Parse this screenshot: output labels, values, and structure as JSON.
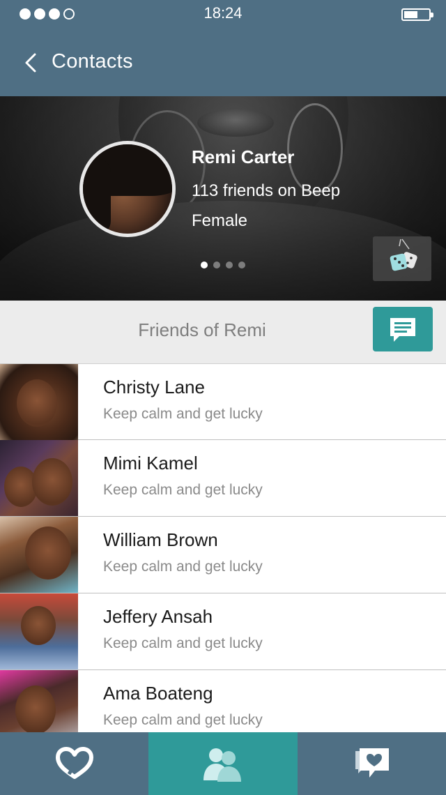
{
  "status_bar": {
    "time": "18:24",
    "signal_dots_filled": 3,
    "signal_dots_total": 4,
    "battery_level": 0.55
  },
  "header": {
    "back_icon": "chevron-left-icon",
    "title": "Contacts"
  },
  "profile": {
    "name": "Remi Carter",
    "friends_line": "113 friends on Beep",
    "gender": "Female",
    "carousel_pages": 4,
    "carousel_active": 1,
    "dice_icon": "dice-icon"
  },
  "friends_section": {
    "title": "Friends of Remi",
    "message_icon": "chat-icon"
  },
  "friends": [
    {
      "name": "Christy Lane",
      "status": "Keep calm and get lucky"
    },
    {
      "name": "Mimi Kamel",
      "status": "Keep calm and get lucky"
    },
    {
      "name": "William Brown",
      "status": "Keep calm and get lucky"
    },
    {
      "name": "Jeffery Ansah",
      "status": "Keep calm and get lucky"
    },
    {
      "name": "Ama Boateng",
      "status": "Keep calm and get lucky"
    }
  ],
  "tabs": [
    {
      "icon": "heart-logo-icon",
      "active": false
    },
    {
      "icon": "people-icon",
      "active": true
    },
    {
      "icon": "heart-chat-icon",
      "active": false
    }
  ],
  "colors": {
    "header_bg": "#4f6f84",
    "accent_teal": "#2f9a99",
    "section_bg": "#ececec"
  }
}
